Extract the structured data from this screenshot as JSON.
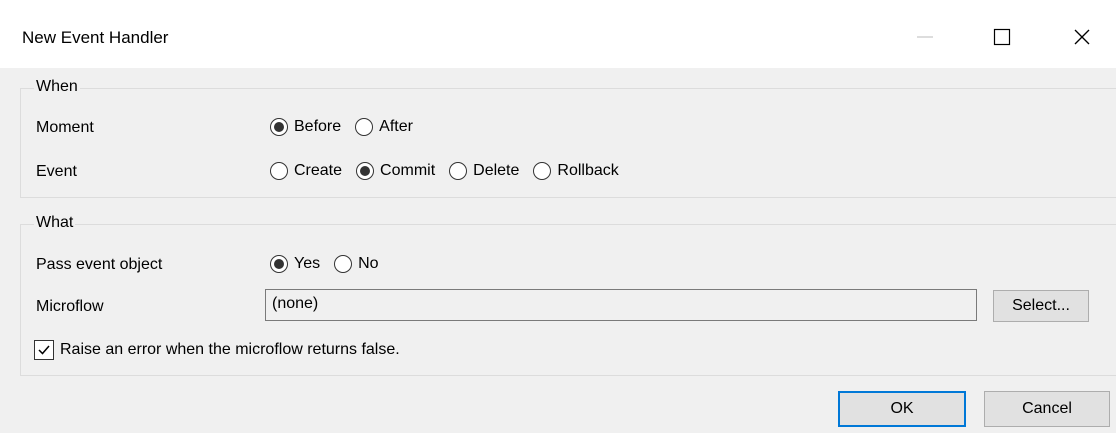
{
  "window": {
    "title": "New Event Handler",
    "minimize_icon": "minimize-icon",
    "maximize_icon": "maximize-icon",
    "close_icon": "close-icon"
  },
  "when": {
    "group_title": "When",
    "moment": {
      "label": "Moment",
      "options": [
        {
          "label": "Before",
          "selected": true
        },
        {
          "label": "After",
          "selected": false
        }
      ]
    },
    "event": {
      "label": "Event",
      "options": [
        {
          "label": "Create",
          "selected": false
        },
        {
          "label": "Commit",
          "selected": true
        },
        {
          "label": "Delete",
          "selected": false
        },
        {
          "label": "Rollback",
          "selected": false
        }
      ]
    }
  },
  "what": {
    "group_title": "What",
    "pass_event_object": {
      "label": "Pass event object",
      "options": [
        {
          "label": "Yes",
          "selected": true
        },
        {
          "label": "No",
          "selected": false
        }
      ]
    },
    "microflow": {
      "label": "Microflow",
      "value": "(none)",
      "select_label": "Select..."
    },
    "raise_error": {
      "label": "Raise an error when the microflow returns false.",
      "checked": true
    }
  },
  "footer": {
    "ok_label": "OK",
    "cancel_label": "Cancel"
  },
  "colors": {
    "accent": "#0078d7",
    "dialog_bg": "#f0f0f0",
    "titlebar_bg": "#ffffff"
  }
}
